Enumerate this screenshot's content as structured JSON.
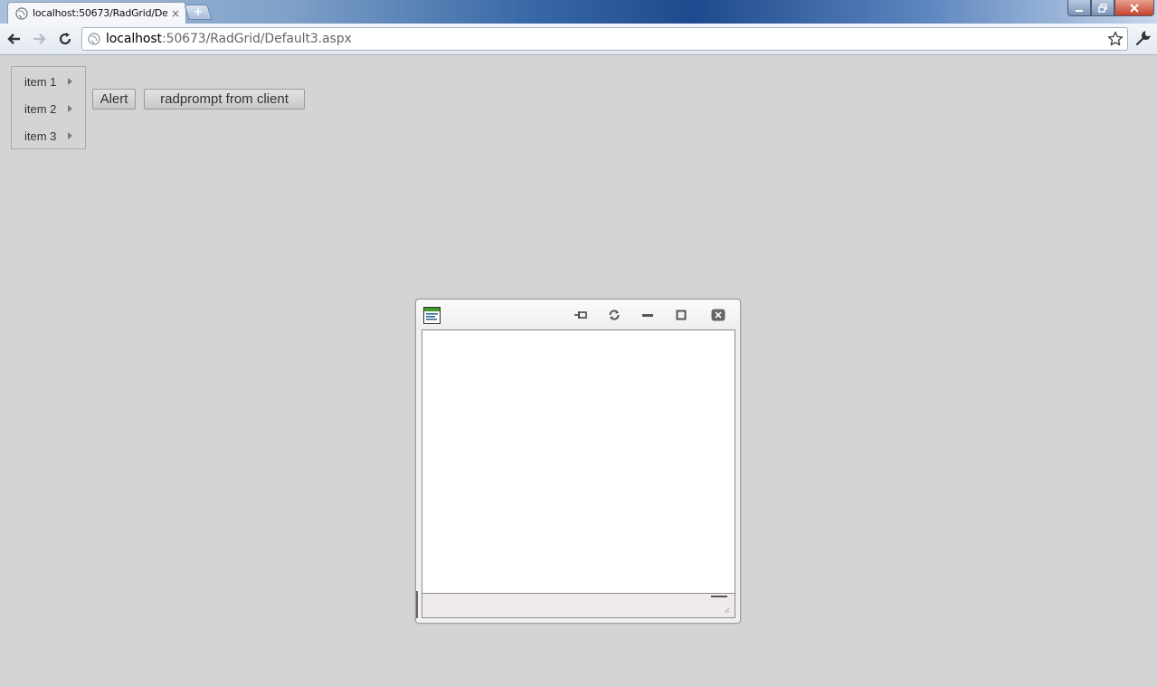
{
  "browser": {
    "tab": {
      "title": "localhost:50673/RadGrid/De",
      "favicon": "globe-icon",
      "close_icon": "close-icon"
    },
    "new_tab_label": "+",
    "window_controls": [
      "minimize-icon",
      "restore-icon",
      "close-icon"
    ],
    "nav": {
      "back": "back-arrow-icon",
      "forward": "forward-arrow-icon",
      "reload": "reload-icon"
    },
    "address": {
      "host": "localhost",
      "path": ":50673/RadGrid/Default3.aspx"
    },
    "bookmark_icon": "star-icon",
    "menu_icon": "wrench-icon"
  },
  "page": {
    "menu": {
      "items": [
        {
          "label": "item 1"
        },
        {
          "label": "item 2"
        },
        {
          "label": "item 3"
        }
      ]
    },
    "buttons": {
      "alert": "Alert",
      "prompt": "radprompt from client"
    },
    "radwindow": {
      "title": "",
      "icons": [
        "window-app-icon",
        "pin-icon",
        "reload-icon",
        "minimize-icon",
        "maximize-icon",
        "close-icon"
      ]
    }
  },
  "colors": {
    "page_background": "#d4d4d4",
    "window_background": "#f0f0f0",
    "status_bar": "#efebeb"
  }
}
